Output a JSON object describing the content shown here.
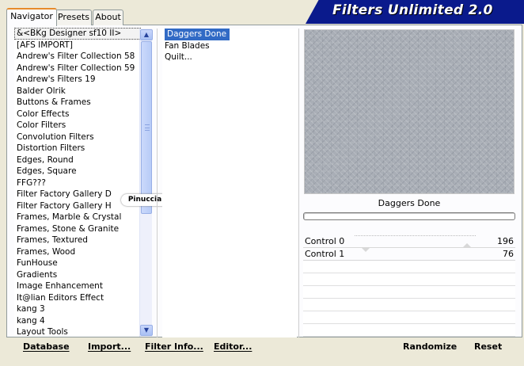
{
  "banner": {
    "title": "Filters Unlimited 2.0"
  },
  "tabs": [
    {
      "label": "Navigator"
    },
    {
      "label": "Presets"
    },
    {
      "label": "About"
    }
  ],
  "categories": [
    "&<BKg Designer sf10 II>",
    "[AFS IMPORT]",
    "Andrew's Filter Collection 58",
    "Andrew's Filter Collection 59",
    "Andrew's Filters 19",
    "Balder Olrik",
    "Buttons & Frames",
    "Color Effects",
    "Color Filters",
    "Convolution Filters",
    "Distortion Filters",
    "Edges, Round",
    "Edges, Square",
    "FFG???",
    "Filter Factory Gallery D",
    "Filter Factory Gallery H",
    "Frames, Marble & Crystal",
    "Frames, Stone & Granite",
    "Frames, Textured",
    "Frames, Wood",
    "FunHouse",
    "Gradients",
    "Image Enhancement",
    "It@lian Editors Effect",
    "kang 3",
    "kang 4",
    "Layout Tools"
  ],
  "watermark": "Pinuccia",
  "filters": [
    "Daggers Done",
    "Fan Blades",
    "Quilt..."
  ],
  "preview": {
    "name": "Daggers Done"
  },
  "controls": [
    {
      "label": "Control 0",
      "value": "196"
    },
    {
      "label": "Control  1",
      "value": "76"
    }
  ],
  "buttons": {
    "database": "Database",
    "import": "Import...",
    "filter_info": "Filter Info...",
    "editor": "Editor...",
    "randomize": "Randomize",
    "reset": "Reset"
  },
  "colors": {
    "banner": "#0a1a8c",
    "selection": "#316ac5"
  }
}
